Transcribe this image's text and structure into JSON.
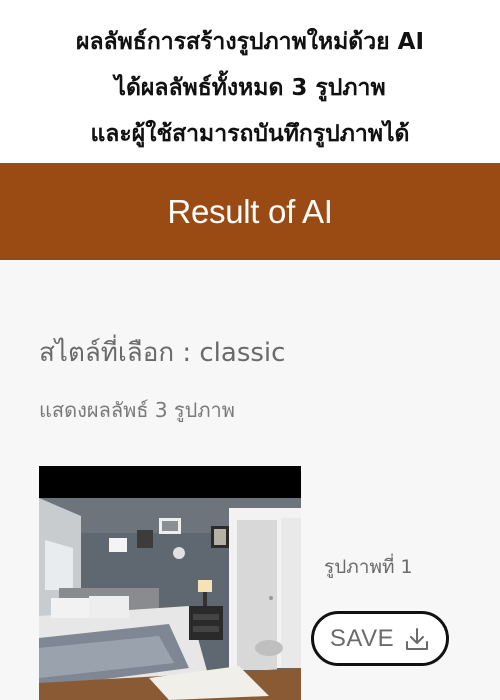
{
  "caption": {
    "line1": "ผลลัพธ์การสร้างรูปภาพใหม่ด้วย AI",
    "line2": "ได้ผลลัพธ์ทั้งหมด 3 รูปภาพ",
    "line3": "และผู้ใช้สามารถบันทึกรูปภาพได้"
  },
  "header": {
    "title": "Result of AI",
    "background_color": "#9a4a13"
  },
  "main": {
    "style_heading": "สไตล์ที่เลือก : classic",
    "result_count": "แสดงผลลัพธ์ 3 รูปภาพ",
    "results": [
      {
        "label": "รูปภาพที่ 1",
        "image": "bedroom-photo",
        "save_label": "SAVE",
        "save_icon": "download-icon"
      }
    ]
  }
}
